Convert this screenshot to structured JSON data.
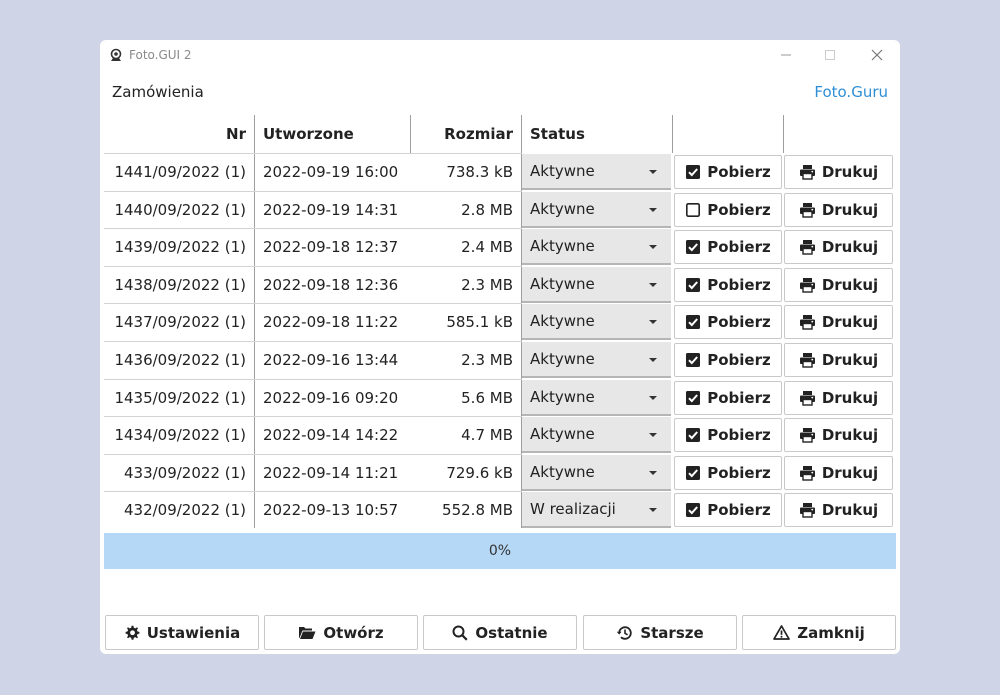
{
  "window": {
    "title": "Foto.GUI 2"
  },
  "header": {
    "section_label": "Zamówienia",
    "brand_link": "Foto.Guru"
  },
  "table": {
    "columns": {
      "nr": "Nr",
      "created": "Utworzone",
      "size": "Rozmiar",
      "status": "Status"
    },
    "rows": [
      {
        "nr": "1441/09/2022 (1)",
        "created": "2022-09-19 16:00",
        "size": "738.3 kB",
        "status": "Aktywne",
        "download_checked": true
      },
      {
        "nr": "1440/09/2022 (1)",
        "created": "2022-09-19 14:31",
        "size": "2.8 MB",
        "status": "Aktywne",
        "download_checked": false
      },
      {
        "nr": "1439/09/2022 (1)",
        "created": "2022-09-18 12:37",
        "size": "2.4 MB",
        "status": "Aktywne",
        "download_checked": true
      },
      {
        "nr": "1438/09/2022 (1)",
        "created": "2022-09-18 12:36",
        "size": "2.3 MB",
        "status": "Aktywne",
        "download_checked": true
      },
      {
        "nr": "1437/09/2022 (1)",
        "created": "2022-09-18 11:22",
        "size": "585.1 kB",
        "status": "Aktywne",
        "download_checked": true
      },
      {
        "nr": "1436/09/2022 (1)",
        "created": "2022-09-16 13:44",
        "size": "2.3 MB",
        "status": "Aktywne",
        "download_checked": true
      },
      {
        "nr": "1435/09/2022 (1)",
        "created": "2022-09-16 09:20",
        "size": "5.6 MB",
        "status": "Aktywne",
        "download_checked": true
      },
      {
        "nr": "1434/09/2022 (1)",
        "created": "2022-09-14 14:22",
        "size": "4.7 MB",
        "status": "Aktywne",
        "download_checked": true
      },
      {
        "nr": "433/09/2022 (1)",
        "created": "2022-09-14 11:21",
        "size": "729.6 kB",
        "status": "Aktywne",
        "download_checked": true
      },
      {
        "nr": "432/09/2022 (1)",
        "created": "2022-09-13 10:57",
        "size": "552.8 MB",
        "status": "W realizacji",
        "download_checked": true
      }
    ],
    "download_label": "Pobierz",
    "print_label": "Drukuj"
  },
  "progress": {
    "label": "0%",
    "value": 0
  },
  "footer": {
    "settings": "Ustawienia",
    "open": "Otwórz",
    "recent": "Ostatnie",
    "older": "Starsze",
    "close": "Zamknij"
  },
  "colors": {
    "accent": "#2e8fd6",
    "progress_bg": "#b5d8f7",
    "background": "#cfd5e6"
  }
}
